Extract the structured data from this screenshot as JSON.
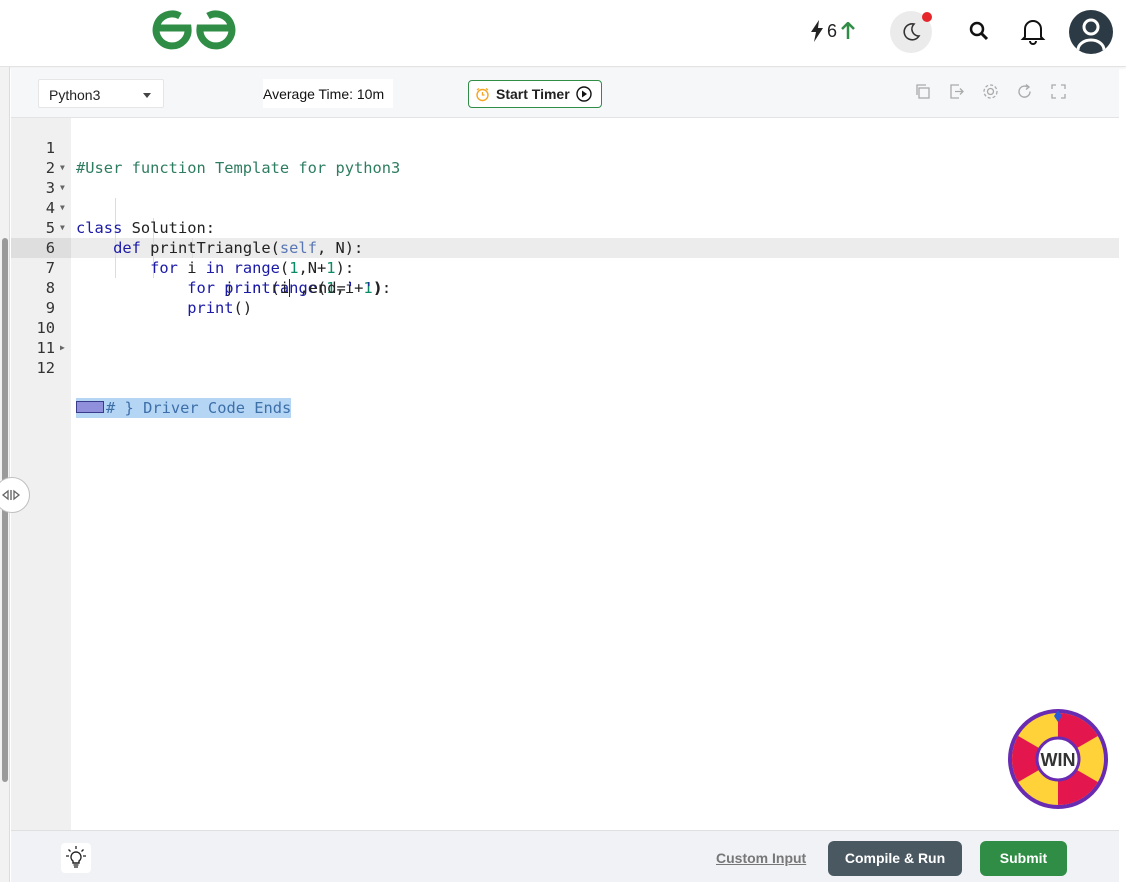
{
  "header": {
    "logo_icon": "gfg-logo-icon",
    "streak_count": "6",
    "streak_icon": "lightning-bolt-icon",
    "streak_trend_icon": "arrow-up-icon",
    "accent": "#2f8d46",
    "notification_dot_color": "#e5262b"
  },
  "toolbar": {
    "language": "Python3",
    "average_time": "Average Time: 10m",
    "timer_label": "Start Timer",
    "icons": [
      "copy-icon",
      "import-icon",
      "settings-icon",
      "reset-icon",
      "fullscreen-icon"
    ]
  },
  "editor": {
    "lines": [
      {
        "n": "1"
      },
      {
        "n": "2"
      },
      {
        "n": "3"
      },
      {
        "n": "4"
      },
      {
        "n": "5"
      },
      {
        "n": "6"
      },
      {
        "n": "7"
      },
      {
        "n": "8"
      },
      {
        "n": "9"
      },
      {
        "n": "10"
      },
      {
        "n": "11"
      },
      {
        "n": "12"
      }
    ],
    "code": {
      "l1": "#User function Template for python3",
      "l3_kw": "class",
      "l3_rest": " Solution:",
      "l4_kw": "def",
      "l4_name": " printTriangle(",
      "l4_self": "self",
      "l4_rest": ", N):",
      "l5_kw1": "for",
      "l5_var": " i ",
      "l5_kw2": "in",
      "l5_fn": " range",
      "l5_p1": "(",
      "l5_n1": "1",
      "l5_p2": ",N+",
      "l5_n2": "1",
      "l5_p3": "):",
      "l6_kw1": "for",
      "l6_var": " j ",
      "l6_kw2": "in",
      "l6_fn": " range",
      "l6_p1": "(",
      "l6_n1": "1",
      "l6_p2": ",i+",
      "l6_n2": "1",
      "l6_p3": "):",
      "l7_fn": "print",
      "l7_p1": "(i",
      "l7_p2": " ,end=",
      "l7_str": "' '",
      "l7_p3": ")",
      "l8_fn": "print",
      "l8_p1": "()",
      "l12": "# } Driver Code Ends"
    }
  },
  "bottom": {
    "custom_input": "Custom Input",
    "compile": "Compile & Run",
    "submit": "Submit",
    "win_label": "WIN"
  }
}
